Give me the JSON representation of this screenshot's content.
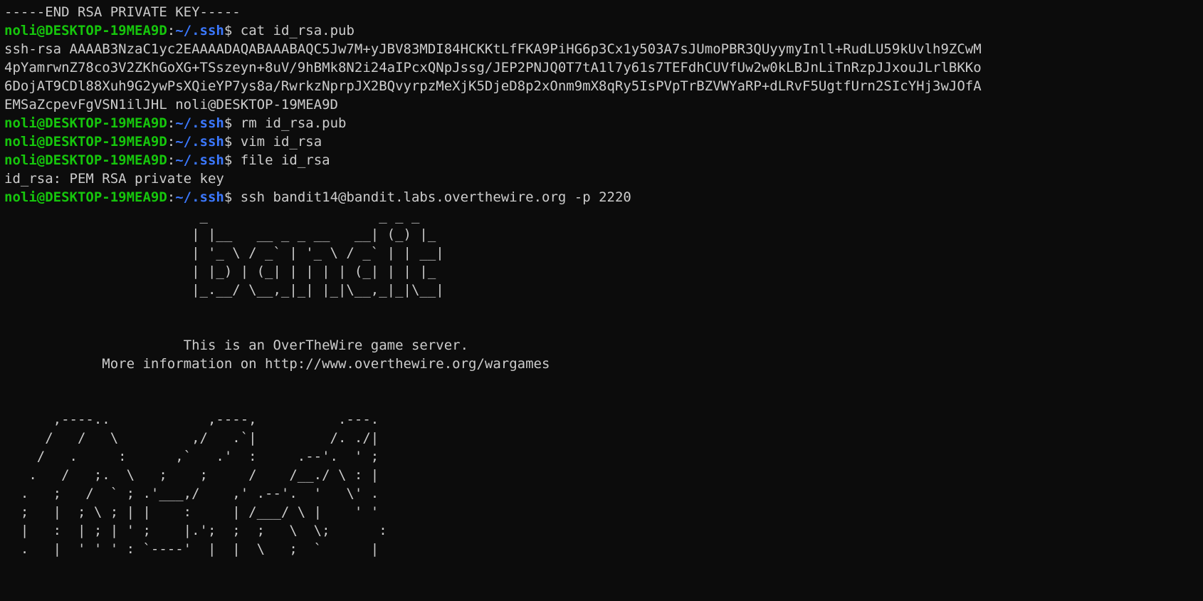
{
  "colors": {
    "background": "#0c0c0c",
    "foreground": "#cccccc",
    "prompt_user": "#16c60c",
    "prompt_path": "#3b78ff"
  },
  "prompt": {
    "user_host": "noli@DESKTOP-19MEA9D",
    "sep": ":",
    "path": "~/.ssh",
    "symbol": "$ "
  },
  "lines": [
    {
      "type": "out",
      "text": "-----END RSA PRIVATE KEY-----"
    },
    {
      "type": "prompt",
      "cmd": "cat id_rsa.pub"
    },
    {
      "type": "out",
      "text": "ssh-rsa AAAAB3NzaC1yc2EAAAADAQABAAABAQC5Jw7M+yJBV83MDI84HCKKtLfFKA9PiHG6p3Cx1y503A7sJUmoPBR3QUyymyInll+RudLU59kUvlh9ZCwM"
    },
    {
      "type": "out",
      "text": "4pYamrwnZ78co3V2ZKhGoXG+TSszeyn+8uV/9hBMk8N2i24aIPcxQNpJssg/JEP2PNJQ0T7tA1l7y61s7TEFdhCUVfUw2w0kLBJnLiTnRzpJJxouJLrlBKKo"
    },
    {
      "type": "out",
      "text": "6DojAT9CDl88Xuh9G2ywPsXQieYP7ys8a/RwrkzNprpJX2BQvyrpzMeXjK5DjeD8p2xOnm9mX8qRy5IsPVpTrBZVWYaRP+dLRvF5UgtfUrn2SIcYHj3wJOfA"
    },
    {
      "type": "out",
      "text": "EMSaZcpevFgVSN1ilJHL noli@DESKTOP-19MEA9D"
    },
    {
      "type": "prompt",
      "cmd": "rm id_rsa.pub"
    },
    {
      "type": "prompt",
      "cmd": "vim id_rsa"
    },
    {
      "type": "prompt",
      "cmd": "file id_rsa"
    },
    {
      "type": "out",
      "text": "id_rsa: PEM RSA private key"
    },
    {
      "type": "prompt",
      "cmd": "ssh bandit14@bandit.labs.overthewire.org -p 2220"
    },
    {
      "type": "out",
      "text": "                        _                     _ _ _"
    },
    {
      "type": "out",
      "text": "                       | |__   __ _ _ __   __| (_) |_"
    },
    {
      "type": "out",
      "text": "                       | '_ \\ / _` | '_ \\ / _` | | __|"
    },
    {
      "type": "out",
      "text": "                       | |_) | (_| | | | | (_| | | |_"
    },
    {
      "type": "out",
      "text": "                       |_.__/ \\__,_|_| |_|\\__,_|_|\\__|"
    },
    {
      "type": "out",
      "text": ""
    },
    {
      "type": "out",
      "text": ""
    },
    {
      "type": "out",
      "text": "                      This is an OverTheWire game server."
    },
    {
      "type": "out",
      "text": "            More information on http://www.overthewire.org/wargames"
    },
    {
      "type": "out",
      "text": ""
    },
    {
      "type": "out",
      "text": ""
    },
    {
      "type": "out",
      "text": "      ,----..            ,----,          .---."
    },
    {
      "type": "out",
      "text": "     /   /   \\         ,/   .`|         /. ./|"
    },
    {
      "type": "out",
      "text": "    /   .     :      ,`   .'  :     .--'.  ' ;"
    },
    {
      "type": "out",
      "text": "   .   /   ;.  \\   ;    ;     /    /__./ \\ : |"
    },
    {
      "type": "out",
      "text": "  .   ;   /  ` ; .'___,/    ,' .--'.  '   \\' ."
    },
    {
      "type": "out",
      "text": "  ;   |  ; \\ ; | |    :     | /___/ \\ |    ' '"
    },
    {
      "type": "out",
      "text": "  |   :  | ; | ' ;    |.';  ;  ;   \\  \\;      :"
    },
    {
      "type": "out",
      "text": "  .   |  ' ' ' : `----'  |  |  \\   ;  `      |"
    }
  ]
}
